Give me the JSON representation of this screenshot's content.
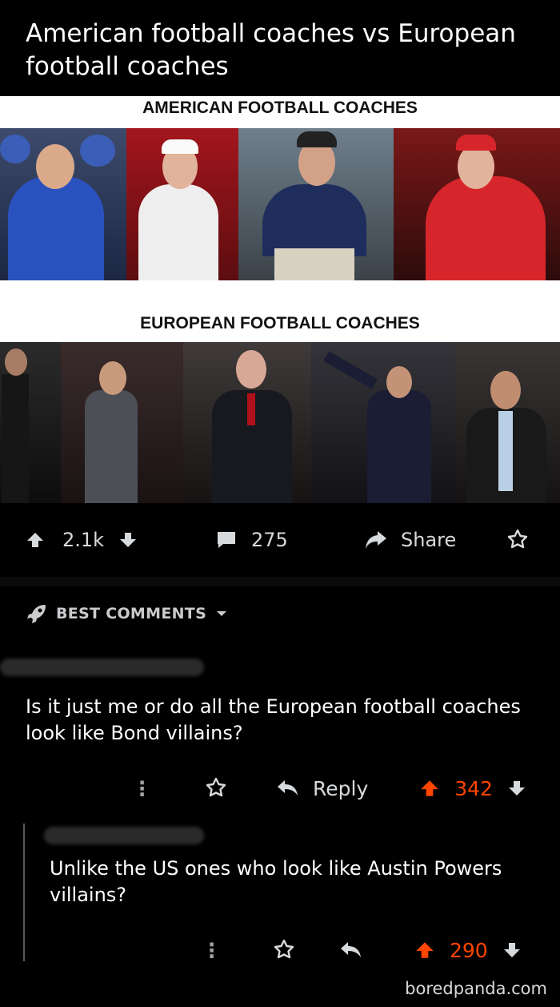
{
  "post": {
    "title": "American football coaches vs European football coaches",
    "meme": {
      "top_heading": "AMERICAN FOOTBALL COACHES",
      "bottom_heading": "EUROPEAN FOOTBALL COACHES"
    },
    "actions": {
      "upvotes": "2.1k",
      "comments": "275",
      "share": "Share"
    }
  },
  "comments_header": {
    "label": "BEST COMMENTS"
  },
  "comments": [
    {
      "text": "Is it just me or do all the European football coaches look like Bond villains?",
      "reply_label": "Reply",
      "score": "342"
    },
    {
      "text": "Unlike the US ones who look like Austin Powers villains?",
      "score": "290"
    }
  ],
  "watermark": "boredpanda.com",
  "colors": {
    "accent": "#ff4500",
    "background": "#000000",
    "text": "#d7dadc"
  }
}
